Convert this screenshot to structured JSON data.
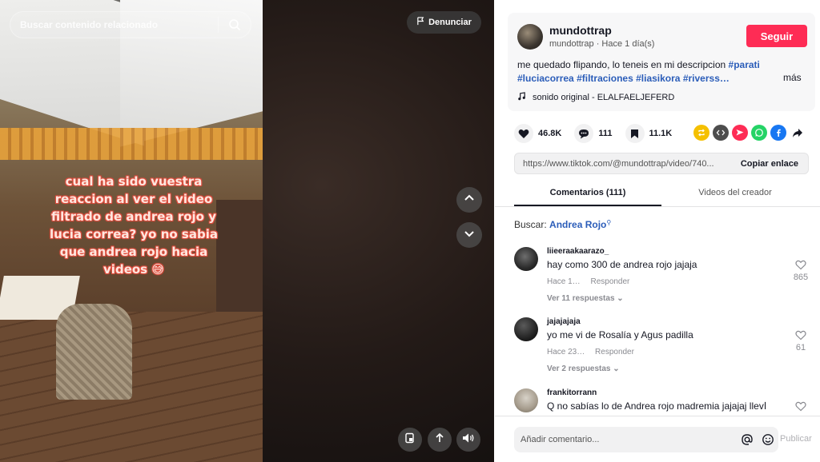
{
  "video": {
    "search_placeholder": "Buscar contenido relacionado",
    "overlay_text": "cual ha sido vuestra reaccion al ver el video filtrado de andrea rojo y lucia correa? yo no sabia que andrea rojo hacia videos 😅",
    "report_label": "Denunciar"
  },
  "author": {
    "username": "mundottrap",
    "meta": "mundottrap · Hace 1 día(s)",
    "follow_label": "Seguir"
  },
  "description": {
    "text": "me quedado flipando, lo teneis en mi descripcion",
    "tags": [
      "#parati",
      "#luciacorrea",
      "#filtraciones",
      "#liasikora",
      "#riverss…"
    ],
    "more_label": "más"
  },
  "sound": {
    "label": "sonido original - ELALFAELJEFERD"
  },
  "stats": {
    "likes": "46.8K",
    "comments": "111",
    "saves": "11.1K"
  },
  "share": {
    "url": "https://www.tiktok.com/@mundottrap/video/740...",
    "copy_label": "Copiar enlace",
    "accent_colors": {
      "repost": "#f5c000",
      "embed": "#4d4d4d",
      "send": "#fe2c55",
      "whatsapp": "#25d366",
      "facebook": "#1877f2",
      "more": "#161823"
    }
  },
  "tabs": [
    {
      "label": "Comentarios (111)",
      "active": true
    },
    {
      "label": "Videos del creador",
      "active": false
    }
  ],
  "search": {
    "prefix": "Buscar:",
    "query": "Andrea Rojo"
  },
  "comments": [
    {
      "user": "liieeraakaarazo_",
      "text": "hay como 300 de andrea rojo jajaja",
      "time": "Hace 1…",
      "reply": "Responder",
      "replies": "Ver 11 respuestas",
      "likes": "865"
    },
    {
      "user": "jajajajaja",
      "text": "yo me vi de Rosalía y Agus padilla",
      "time": "Hace 23…",
      "reply": "Responder",
      "replies": "Ver 2 respuestas",
      "likes": "61"
    },
    {
      "user": "frankitorrann",
      "text": "Q no sabías lo de Andrea rojo madremia jajajaj llevا",
      "time": "",
      "reply": "",
      "replies": "",
      "likes": ""
    }
  ],
  "composer": {
    "placeholder": "Añadir comentario...",
    "post_label": "Publicar"
  }
}
